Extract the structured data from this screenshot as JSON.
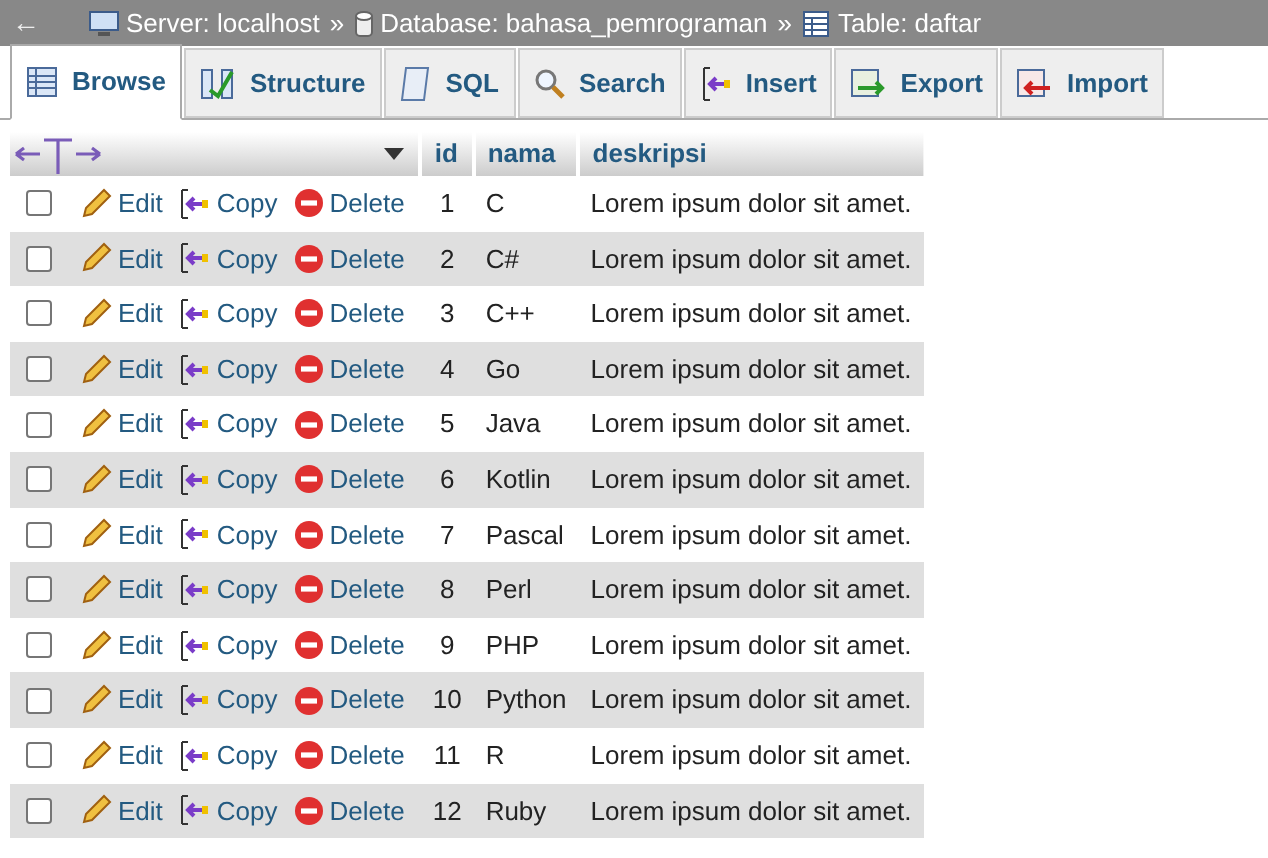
{
  "breadcrumb": {
    "back": "←",
    "items": [
      {
        "kind": "server",
        "label": "Server: localhost"
      },
      {
        "kind": "database",
        "label": "Database: bahasa_pemrograman"
      },
      {
        "kind": "table",
        "label": "Table: daftar"
      }
    ],
    "separator": "»"
  },
  "tabs": [
    {
      "kind": "browse",
      "label": "Browse",
      "selected": true
    },
    {
      "kind": "structure",
      "label": "Structure",
      "selected": false
    },
    {
      "kind": "sql",
      "label": "SQL",
      "selected": false
    },
    {
      "kind": "search",
      "label": "Search",
      "selected": false
    },
    {
      "kind": "insert",
      "label": "Insert",
      "selected": false
    },
    {
      "kind": "export",
      "label": "Export",
      "selected": false
    },
    {
      "kind": "import",
      "label": "Import",
      "selected": false
    }
  ],
  "table": {
    "columns": [
      "id",
      "nama",
      "deskripsi"
    ],
    "rows": [
      {
        "checked": false,
        "edit": "Edit",
        "copy": "Copy",
        "delete": "Delete",
        "id": "1",
        "nama": "C",
        "deskripsi": "Lorem ipsum dolor sit amet."
      },
      {
        "checked": false,
        "edit": "Edit",
        "copy": "Copy",
        "delete": "Delete",
        "id": "2",
        "nama": "C#",
        "deskripsi": "Lorem ipsum dolor sit amet."
      },
      {
        "checked": false,
        "edit": "Edit",
        "copy": "Copy",
        "delete": "Delete",
        "id": "3",
        "nama": "C++",
        "deskripsi": "Lorem ipsum dolor sit amet."
      },
      {
        "checked": false,
        "edit": "Edit",
        "copy": "Copy",
        "delete": "Delete",
        "id": "4",
        "nama": "Go",
        "deskripsi": "Lorem ipsum dolor sit amet."
      },
      {
        "checked": false,
        "edit": "Edit",
        "copy": "Copy",
        "delete": "Delete",
        "id": "5",
        "nama": "Java",
        "deskripsi": "Lorem ipsum dolor sit amet."
      },
      {
        "checked": false,
        "edit": "Edit",
        "copy": "Copy",
        "delete": "Delete",
        "id": "6",
        "nama": "Kotlin",
        "deskripsi": "Lorem ipsum dolor sit amet."
      },
      {
        "checked": false,
        "edit": "Edit",
        "copy": "Copy",
        "delete": "Delete",
        "id": "7",
        "nama": "Pascal",
        "deskripsi": "Lorem ipsum dolor sit amet."
      },
      {
        "checked": false,
        "edit": "Edit",
        "copy": "Copy",
        "delete": "Delete",
        "id": "8",
        "nama": "Perl",
        "deskripsi": "Lorem ipsum dolor sit amet."
      },
      {
        "checked": false,
        "edit": "Edit",
        "copy": "Copy",
        "delete": "Delete",
        "id": "9",
        "nama": "PHP",
        "deskripsi": "Lorem ipsum dolor sit amet."
      },
      {
        "checked": false,
        "edit": "Edit",
        "copy": "Copy",
        "delete": "Delete",
        "id": "10",
        "nama": "Python",
        "deskripsi": "Lorem ipsum dolor sit amet."
      },
      {
        "checked": false,
        "edit": "Edit",
        "copy": "Copy",
        "delete": "Delete",
        "id": "11",
        "nama": "R",
        "deskripsi": "Lorem ipsum dolor sit amet."
      },
      {
        "checked": false,
        "edit": "Edit",
        "copy": "Copy",
        "delete": "Delete",
        "id": "12",
        "nama": "Ruby",
        "deskripsi": "Lorem ipsum dolor sit amet."
      }
    ]
  }
}
